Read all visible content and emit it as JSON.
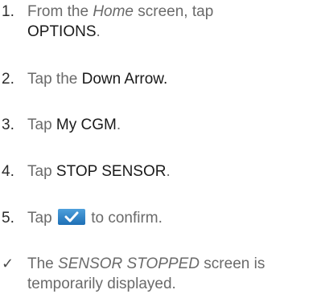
{
  "steps": [
    {
      "marker": "1.",
      "text_1": "From the ",
      "text_italic": "Home",
      "text_2": " screen, tap",
      "text_bold": "OPTIONS",
      "text_end": "."
    },
    {
      "marker": "2.",
      "text_1": "Tap the ",
      "text_bold": "Down Arrow."
    },
    {
      "marker": "3.",
      "text_1": "Tap ",
      "text_bold": "My CGM",
      "text_end": "."
    },
    {
      "marker": "4.",
      "text_1": "Tap ",
      "text_bold": "STOP SENSOR",
      "text_end": "."
    },
    {
      "marker": "5.",
      "text_1": "Tap ",
      "icon": "confirm-check-icon",
      "text_end": " to confirm."
    }
  ],
  "result": {
    "marker": "✓",
    "text_1": "The ",
    "text_italic": "SENSOR STOPPED",
    "text_2": " screen is",
    "text_line2": "temporarily displayed."
  },
  "colors": {
    "body_text": "#6a6a6a",
    "emphasis_text": "#1a1a1a",
    "icon_blue_top": "#4ea0dc",
    "icon_blue_bottom": "#1e6fb5"
  }
}
